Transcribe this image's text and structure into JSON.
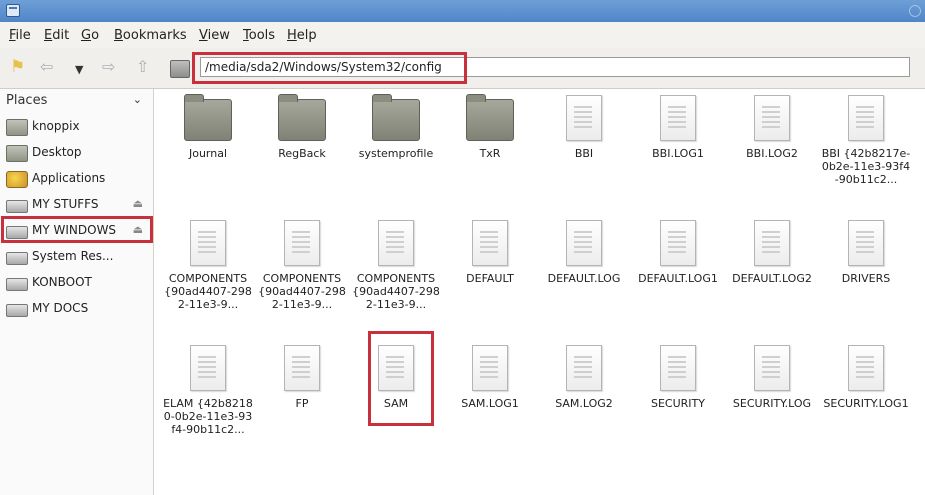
{
  "menu": [
    "File",
    "Edit",
    "Go",
    "Bookmarks",
    "View",
    "Tools",
    "Help"
  ],
  "toolbar": {
    "path": "/media/sda2/Windows/System32/config"
  },
  "sidebar": {
    "header": "Places",
    "items": [
      {
        "label": "knoppix",
        "icon": "folder-icon"
      },
      {
        "label": "Desktop",
        "icon": "folder-icon"
      },
      {
        "label": "Applications",
        "icon": "applications-icon"
      },
      {
        "label": "MY STUFFS",
        "icon": "drive-icon"
      },
      {
        "label": "MY WINDOWS",
        "icon": "drive-icon"
      },
      {
        "label": "System Res...",
        "icon": "drive-icon"
      },
      {
        "label": "KONBOOT",
        "icon": "drive-icon"
      },
      {
        "label": "MY DOCS",
        "icon": "drive-icon"
      }
    ]
  },
  "files": [
    {
      "label": "Journal",
      "type": "folder"
    },
    {
      "label": "RegBack",
      "type": "folder"
    },
    {
      "label": "systemprofile",
      "type": "folder"
    },
    {
      "label": "TxR",
      "type": "folder"
    },
    {
      "label": "BBI",
      "type": "file"
    },
    {
      "label": "BBI.LOG1",
      "type": "file"
    },
    {
      "label": "BBI.LOG2",
      "type": "file"
    },
    {
      "label": "BBI {42b8217e-0b2e-11e3-93f4-90b11c2...",
      "type": "file"
    },
    {
      "label": "COMPONENTS {90ad4407-2982-11e3-9...",
      "type": "file"
    },
    {
      "label": "COMPONENTS {90ad4407-2982-11e3-9...",
      "type": "file"
    },
    {
      "label": "COMPONENTS {90ad4407-2982-11e3-9...",
      "type": "file"
    },
    {
      "label": "DEFAULT",
      "type": "file"
    },
    {
      "label": "DEFAULT.LOG",
      "type": "file"
    },
    {
      "label": "DEFAULT.LOG1",
      "type": "file"
    },
    {
      "label": "DEFAULT.LOG2",
      "type": "file"
    },
    {
      "label": "DRIVERS",
      "type": "file"
    },
    {
      "label": "ELAM {42b82180-0b2e-11e3-93f4-90b11c2...",
      "type": "file"
    },
    {
      "label": "FP",
      "type": "file"
    },
    {
      "label": "SAM",
      "type": "file"
    },
    {
      "label": "SAM.LOG1",
      "type": "file"
    },
    {
      "label": "SAM.LOG2",
      "type": "file"
    },
    {
      "label": "SECURITY",
      "type": "file"
    },
    {
      "label": "SECURITY.LOG",
      "type": "file"
    },
    {
      "label": "SECURITY.LOG1",
      "type": "file"
    }
  ]
}
